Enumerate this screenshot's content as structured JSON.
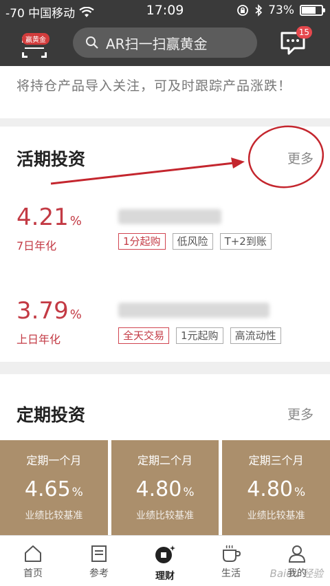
{
  "status_bar": {
    "carrier": "-70 中国移动",
    "time": "17:09",
    "battery": "73%",
    "battery_level": 0.73
  },
  "nav": {
    "scan_badge": "赢黄金",
    "search_placeholder": "AR扫一扫赢黄金",
    "message_count": "15"
  },
  "tip": {
    "text": "将持仓产品导入关注，可及时跟踪产品涨跌！"
  },
  "current_investment": {
    "title": "活期投资",
    "more": "更多",
    "products": [
      {
        "rate": "4.21",
        "unit": "%",
        "rate_label": "7日年化",
        "tags": [
          "1分起购",
          "低风险",
          "T+2到账"
        ]
      },
      {
        "rate": "3.79",
        "unit": "%",
        "rate_label": "上日年化",
        "tags": [
          "全天交易",
          "1元起购",
          "高流动性"
        ]
      }
    ]
  },
  "fixed_investment": {
    "title": "定期投资",
    "more": "更多",
    "cards": [
      {
        "term": "定期一个月",
        "rate": "4.65",
        "unit": "%",
        "note": "业绩比较基准"
      },
      {
        "term": "定期二个月",
        "rate": "4.80",
        "unit": "%",
        "note": "业绩比较基准"
      },
      {
        "term": "定期三个月",
        "rate": "4.80",
        "unit": "%",
        "note": "业绩比较基准"
      }
    ]
  },
  "tabbar": {
    "items": [
      {
        "label": "首页",
        "icon": "home-icon"
      },
      {
        "label": "参考",
        "icon": "document-icon"
      },
      {
        "label": "理财",
        "icon": "wealth-icon"
      },
      {
        "label": "生活",
        "icon": "cup-icon"
      },
      {
        "label": "我的",
        "icon": "person-icon"
      }
    ]
  },
  "watermark": "Baidu 经验"
}
